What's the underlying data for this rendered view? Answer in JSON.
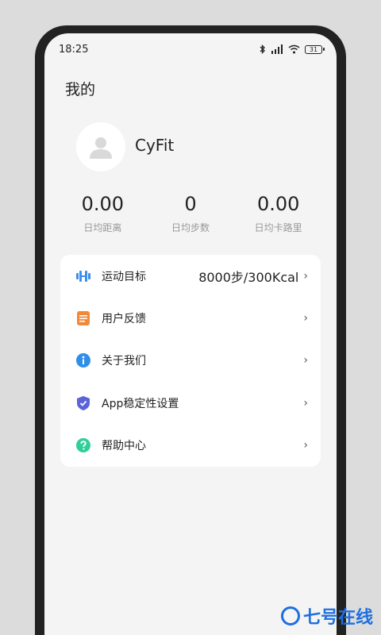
{
  "status_bar": {
    "time": "18:25",
    "battery": "31"
  },
  "page_title": "我的",
  "profile": {
    "name": "CyFit"
  },
  "stats": [
    {
      "value": "0.00",
      "label": "日均距离"
    },
    {
      "value": "0",
      "label": "日均步数"
    },
    {
      "value": "0.00",
      "label": "日均卡路里"
    }
  ],
  "menu": [
    {
      "label": "运动目标",
      "value": "8000步/300Kcal",
      "icon": "dumbbell-icon"
    },
    {
      "label": "用户反馈",
      "value": "",
      "icon": "feedback-icon"
    },
    {
      "label": "关于我们",
      "value": "",
      "icon": "info-icon"
    },
    {
      "label": "App稳定性设置",
      "value": "",
      "icon": "shield-icon"
    },
    {
      "label": "帮助中心",
      "value": "",
      "icon": "help-icon"
    }
  ],
  "watermark": "七号在线",
  "colors": {
    "accent_blue": "#1e6fe0",
    "background": "#f4f4f4"
  }
}
